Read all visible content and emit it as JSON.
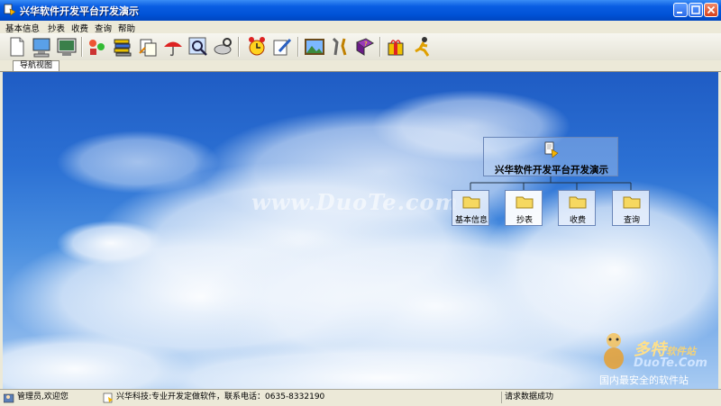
{
  "window": {
    "title": "兴华软件开发平台开发演示"
  },
  "menu": {
    "items": [
      "基本信息",
      "抄表",
      "收费",
      "查询",
      "帮助"
    ]
  },
  "toolbar": {
    "buttons": [
      "new-doc-icon",
      "computer-icon",
      "monitor-icon",
      "people-icon",
      "book-stack-icon",
      "copy-icon",
      "umbrella-icon",
      "magnifier-icon",
      "disk-search-icon",
      "alarm-clock-icon",
      "edit-icon",
      "picture-icon",
      "tools-icon",
      "help-book-icon",
      "gift-icon",
      "run-icon"
    ]
  },
  "tabs": {
    "nav_view": "导航视图"
  },
  "nav_tree": {
    "root": "兴华软件开发平台开发演示",
    "nodes": [
      "基本信息",
      "抄表",
      "收费",
      "查询"
    ]
  },
  "watermarks": {
    "duote": "www.DuoTe.com",
    "brand": "多特",
    "brand_suffix": "软件站",
    "domain": "DuoTe.Com",
    "slogan": "国内最安全的软件站"
  },
  "statusbar": {
    "user": "管理员,欢迎您",
    "company": "兴华科技:专业开发定做软件，联系电话：0635-8332190",
    "status": "请求数据成功"
  },
  "colors": {
    "title_bar": "#0052d6",
    "sky_top": "#1f5cc4",
    "sky_bottom": "#a8cbf2"
  }
}
